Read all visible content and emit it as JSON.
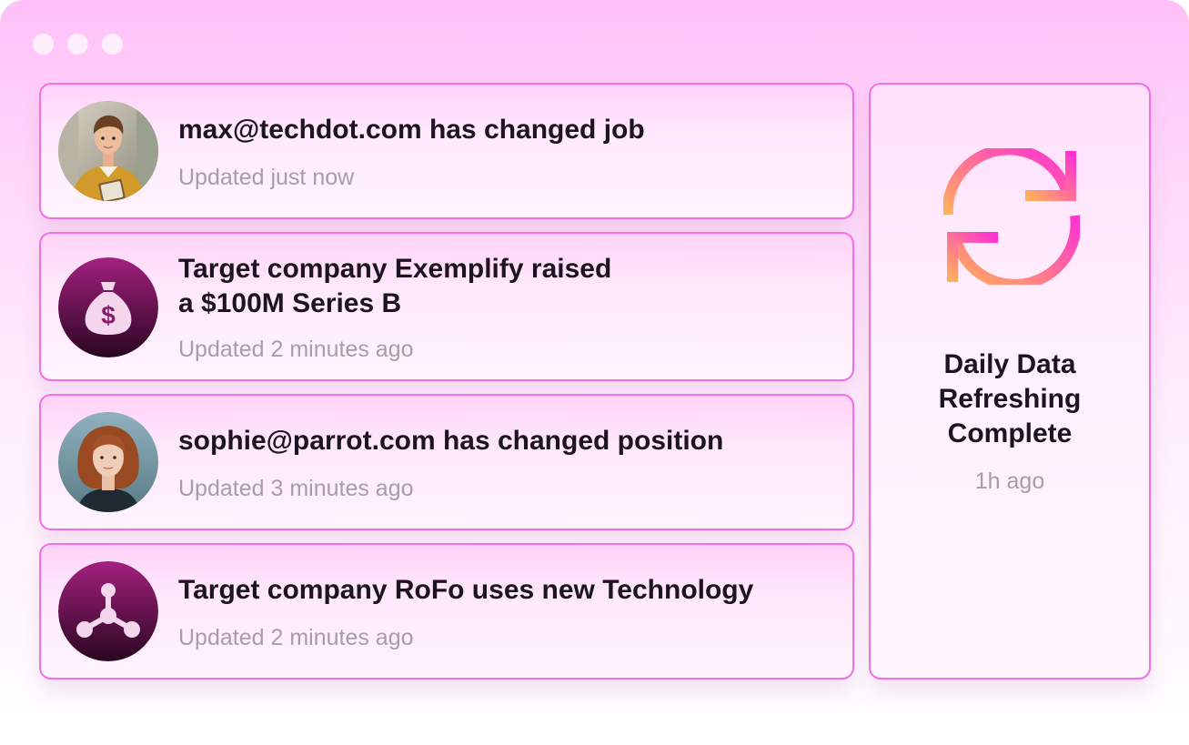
{
  "window": {
    "controls": [
      "dot",
      "dot",
      "dot"
    ]
  },
  "feed": {
    "items": [
      {
        "title": "max@techdot.com has changed job",
        "updated": "Updated just now",
        "avatar_icon": "person-photo-icon"
      },
      {
        "title": "Target company Exemplify raised\na $100M Series B",
        "updated": "Updated 2 minutes ago",
        "avatar_icon": "money-bag-icon"
      },
      {
        "title": "sophie@parrot.com has changed position",
        "updated": "Updated 3 minutes ago",
        "avatar_icon": "person-photo-icon"
      },
      {
        "title": "Target company RoFo uses new Technology",
        "updated": "Updated 2 minutes ago",
        "avatar_icon": "technology-nodes-icon"
      }
    ]
  },
  "status": {
    "title": "Daily Data\nRefreshing\nComplete",
    "time": "1h ago",
    "icon": "refresh-icon"
  },
  "colors": {
    "accent_border": "#f36fe6",
    "title_text": "#1c1420",
    "muted_text": "#a89ca6",
    "icon_circle_top": "#a3207f",
    "icon_circle_bottom": "#2a0621",
    "refresh_gradient_start": "#ffb15a",
    "refresh_gradient_end": "#ff2fd6"
  }
}
